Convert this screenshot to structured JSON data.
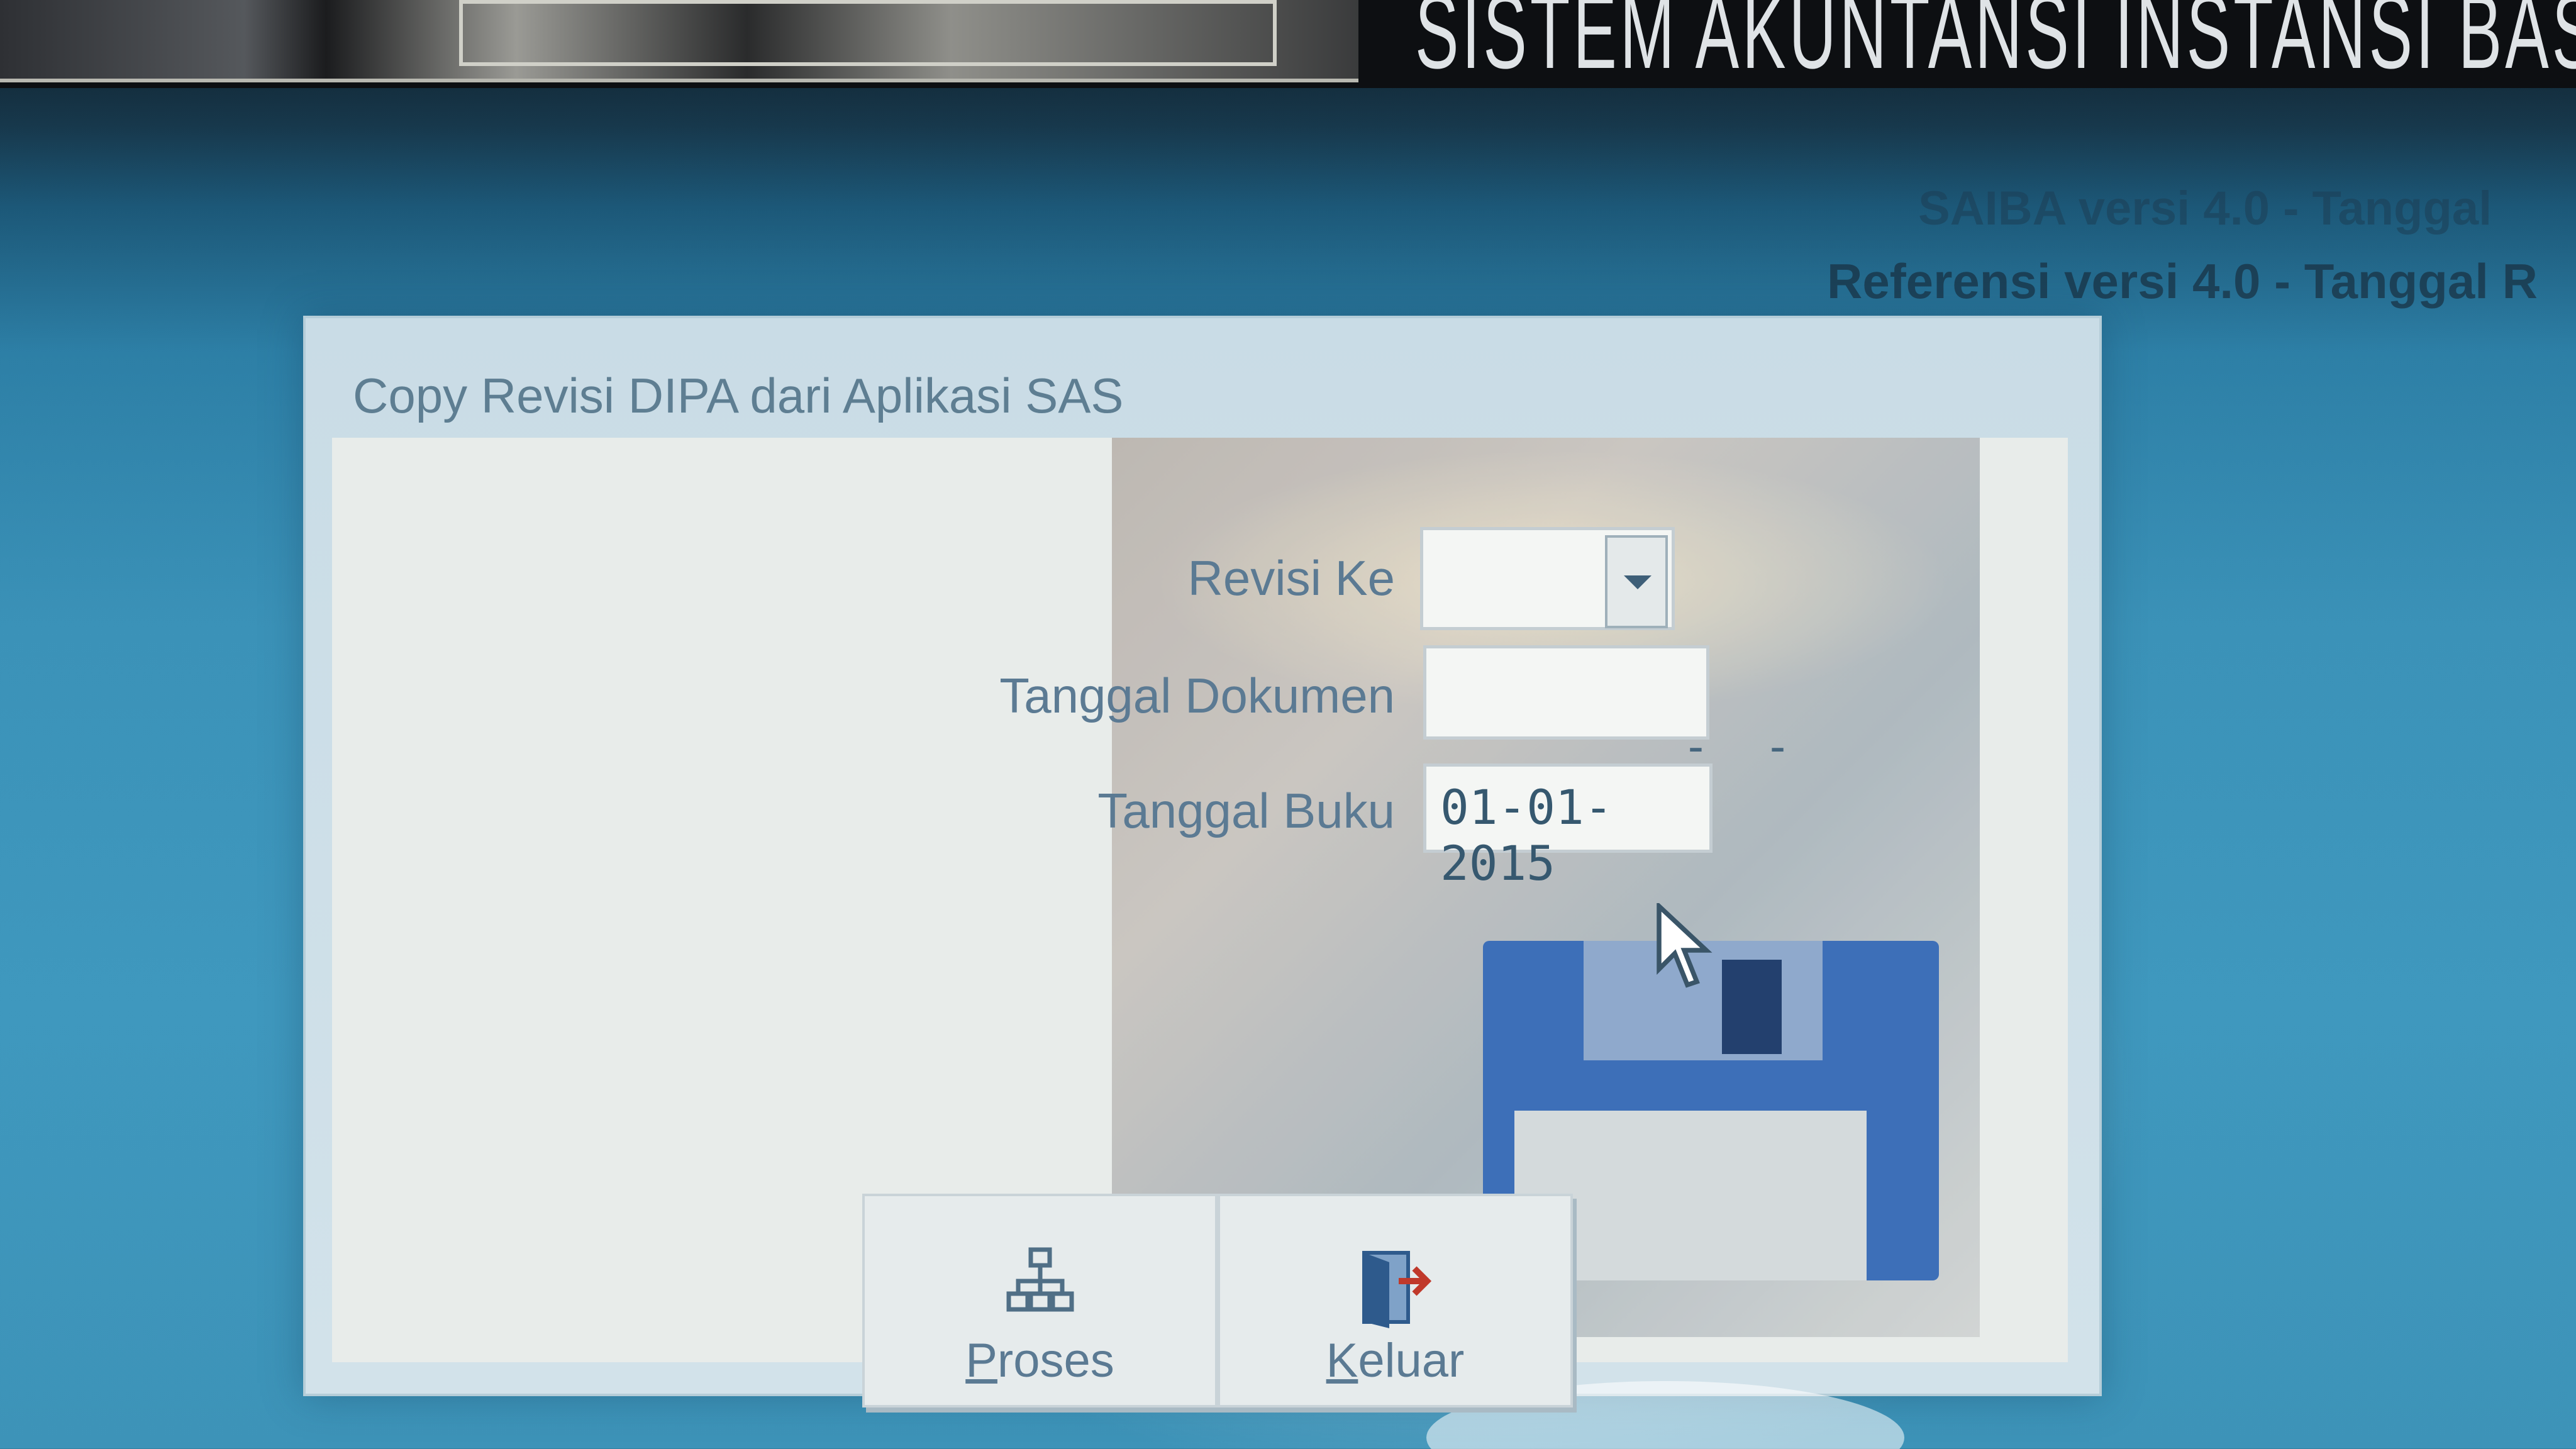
{
  "banner": {
    "title": "SISTEM AKUNTANSI INSTANSI BASIS"
  },
  "version": {
    "line1": "SAIBA versi 4.0 - Tanggal",
    "line2": "Referensi versi 4.0 - Tanggal R"
  },
  "dialog": {
    "title": "Copy Revisi DIPA dari Aplikasi SAS",
    "fields": {
      "revisi_ke": {
        "label": "Revisi Ke",
        "value": ""
      },
      "tanggal_dokumen": {
        "label": "Tanggal Dokumen",
        "value": "  -  -"
      },
      "tanggal_buku": {
        "label": "Tanggal Buku",
        "value": "01-01-2015"
      }
    },
    "buttons": {
      "proses": {
        "mnemonic": "P",
        "rest": "roses",
        "icon": "network-tree-icon"
      },
      "keluar": {
        "mnemonic": "K",
        "rest": "eluar",
        "icon": "exit-door-icon"
      }
    }
  }
}
